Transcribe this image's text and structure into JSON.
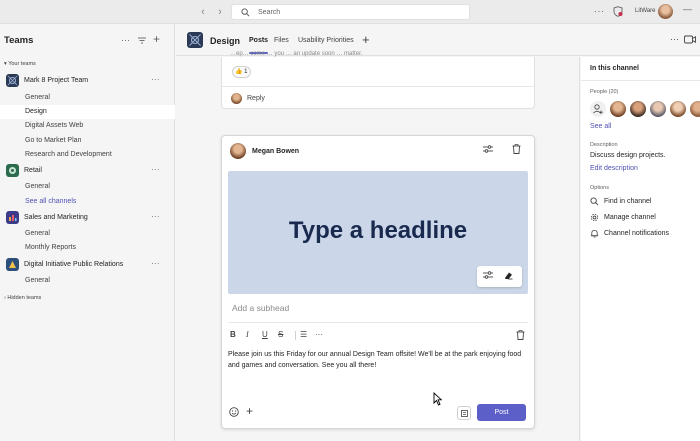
{
  "titlebar": {
    "back_icon": "chevron-left-icon",
    "forward_icon": "chevron-right-icon",
    "search_placeholder": "Search",
    "more_label": "···",
    "org_name": "LitWare",
    "minimize_label": "—"
  },
  "sidebar": {
    "title": "Teams",
    "more_label": "···",
    "filter_icon": "filter-icon",
    "add_label": "+",
    "your_teams_label": "▾ Your teams",
    "hidden_teams_label": "› Hidden teams",
    "teams": [
      {
        "name": "Mark 8 Project Team",
        "dots": "···",
        "color": "#2b3a55",
        "channels": [
          "General",
          "Design",
          "Digital Assets Web",
          "Go to Market Plan",
          "Research and Development"
        ]
      },
      {
        "name": "Retail",
        "dots": "···",
        "color": "#2d6b4f",
        "channels": [
          "General"
        ],
        "see_all": "See all channels"
      },
      {
        "name": "Sales and Marketing",
        "dots": "···",
        "color": "#3c3c8a",
        "channels": [
          "General",
          "Monthly Reports"
        ]
      },
      {
        "name": "Digital Initiative Public Relations",
        "dots": "···",
        "color": "#2c4f7c",
        "channels": [
          "General"
        ]
      }
    ]
  },
  "channel": {
    "title": "Design",
    "tabs": [
      {
        "label": "Posts",
        "selected": true
      },
      {
        "label": "Files",
        "selected": false
      },
      {
        "label": "Usability Priorities",
        "selected": false
      }
    ],
    "add_tab_label": "+",
    "more_label": "···"
  },
  "previous_post": {
    "cut_text": "…ep… come … you … an update soon … matter.",
    "reaction_emoji": "👍",
    "reaction_count": "1",
    "reply_label": "Reply"
  },
  "compose": {
    "author": "Megan Bowen",
    "headline": "Type a headline",
    "subhead_placeholder": "Add a subhead",
    "format": {
      "bold": "B",
      "italic": "I",
      "underline": "U",
      "strike": "S",
      "list": "☰",
      "more": "···"
    },
    "body": "Please join us this Friday for our annual Design Team offsite! We'll be at the park enjoying food and games and conversation. See you all there!",
    "add_label": "+",
    "post_label": "Post",
    "accent_color": "#5b5fc7",
    "banner_color": "#cbd7e8"
  },
  "right_panel": {
    "title": "In this channel",
    "people_label": "People (20)",
    "see_all": "See all",
    "description_label": "Description",
    "description": "Discuss design projects.",
    "edit_description": "Edit description",
    "options_label": "Options",
    "options": [
      {
        "label": "Find in channel",
        "icon": "search-icon"
      },
      {
        "label": "Manage channel",
        "icon": "gear-icon"
      },
      {
        "label": "Channel notifications",
        "icon": "bell-icon"
      }
    ]
  }
}
